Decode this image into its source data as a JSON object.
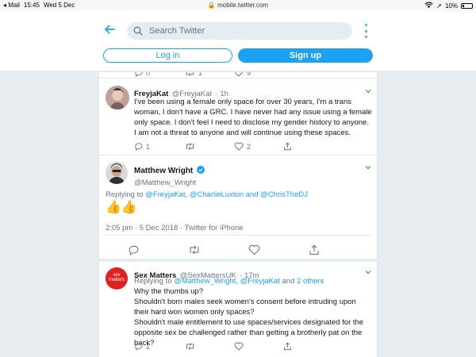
{
  "status_bar": {
    "carrier": "◂ Mail",
    "time": "15:45",
    "date": "Wed 5 Dec",
    "url": "mobile.twitter.com",
    "battery": "10%"
  },
  "header": {
    "search_placeholder": "Search Twitter",
    "login_label": "Log in",
    "signup_label": "Sign up"
  },
  "prev_tweet_actions": {
    "replies": "0",
    "retweets": "1",
    "likes": "9"
  },
  "tweets": [
    {
      "name": "FreyjaKat",
      "handle": "@FreyjaKat",
      "time": "· 1h",
      "text": "I've been using a female only space for over 30 years, I'm a trans woman, I don't have a GRC. I have never had any issue using a female only space. I don't feel I need to disclose my gender history to anyone. I am not a threat to anyone and will continue using these spaces.",
      "replies": "1",
      "retweets": "",
      "likes": "2"
    },
    {
      "name": "Matthew Wright",
      "handle": "@Matthew_Wright",
      "replying_prefix": "Replying to",
      "replying_to": [
        "@FreyjaKat",
        "@CharlieLuxton",
        "@ChrisTheDJ"
      ],
      "replying_sep1": ",",
      "replying_and": "and",
      "text": "👍👍",
      "timestamp": "2:05 pm · 5 Dec 2018 · Twitter for iPhone"
    },
    {
      "name": "Sex Matters",
      "handle": "@SexMattersUK",
      "time": "· 17m",
      "avatar_text": "sex matters",
      "replying_prefix": "Replying to",
      "replying_to": [
        "@Matthew_Wright",
        "@FreyjaKat"
      ],
      "replying_sep1": ",",
      "replying_and": "and",
      "replying_more": "2 others",
      "text": "Why the thumbs up?\nShouldn't born males seek women's consent before intruding upon their hard won women only spaces?\nShouldn't male entitlement to use spaces/services designated for the opposite sex be challenged rather than getting a brotherly pat on the back?",
      "replies": "1",
      "retweets": "",
      "likes": ""
    }
  ],
  "colors": {
    "accent": "#1da1f2",
    "muted": "#657786",
    "background": "#e6ecf0",
    "divider": "#e1e8ed"
  },
  "icons": [
    "back-arrow-icon",
    "search-icon",
    "more-icon",
    "reply-icon",
    "retweet-icon",
    "like-icon",
    "share-icon",
    "chevron-down-icon",
    "verified-icon"
  ]
}
